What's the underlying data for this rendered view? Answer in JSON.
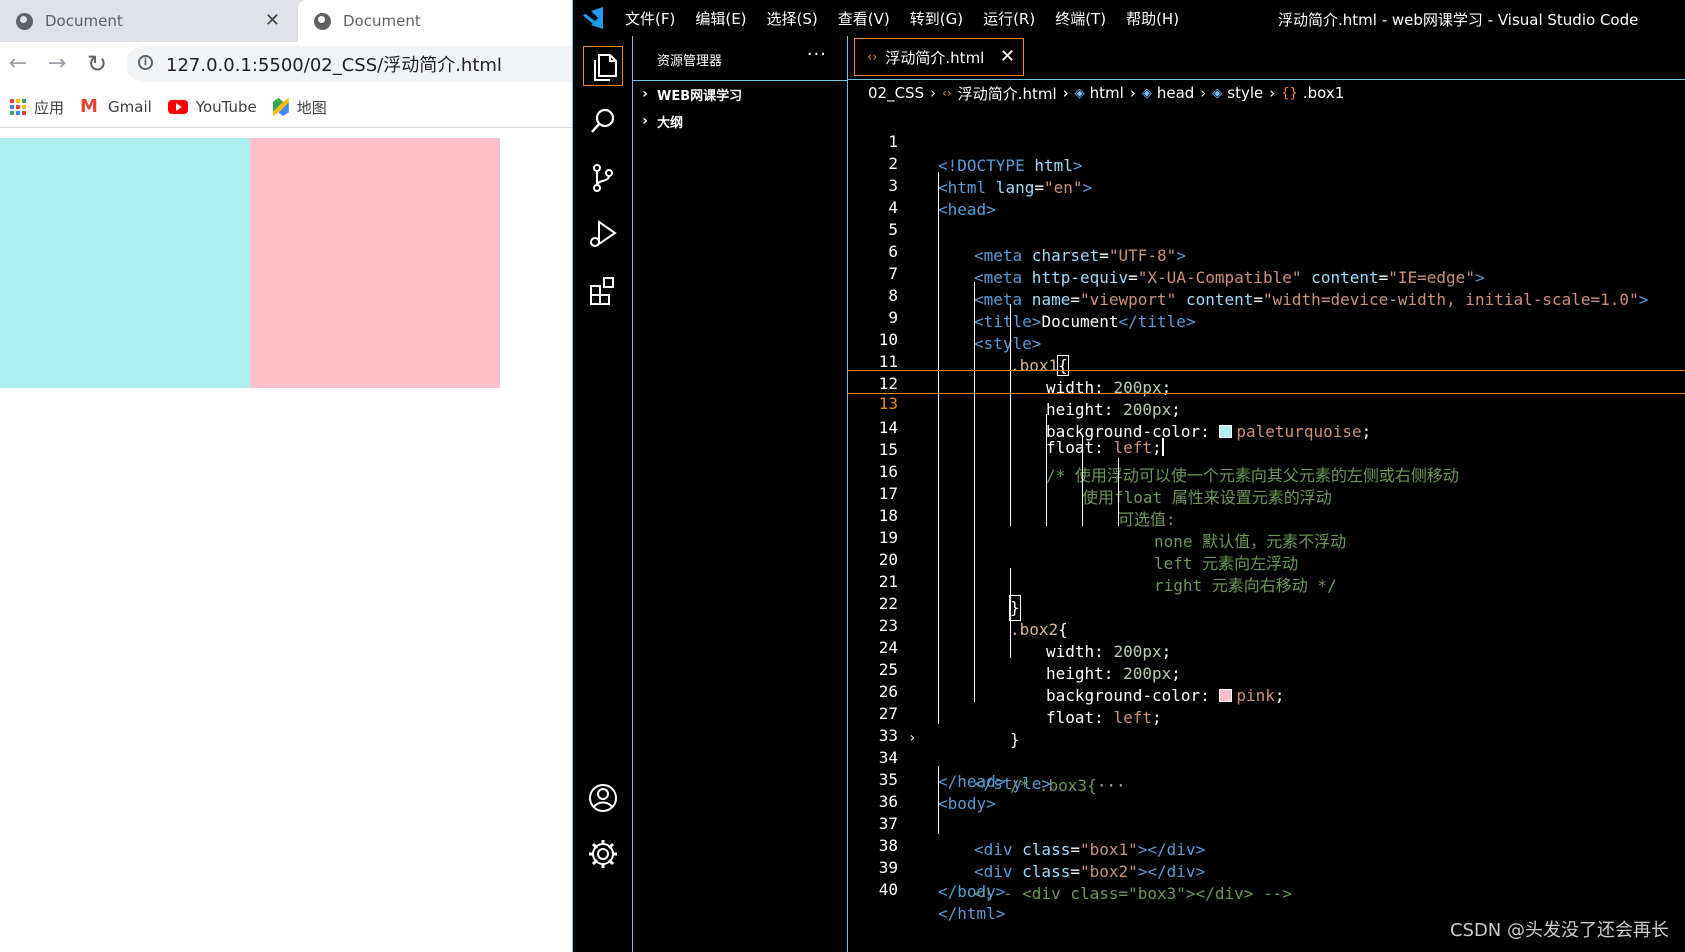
{
  "browser": {
    "tabs": [
      {
        "title": "Document"
      },
      {
        "title": "Document"
      }
    ],
    "url": "127.0.0.1:5500/02_CSS/浮动简介.html",
    "bookmarks": [
      {
        "label": "应用",
        "icon": "apps-icon"
      },
      {
        "label": "Gmail",
        "icon": "gmail-icon"
      },
      {
        "label": "YouTube",
        "icon": "youtube-icon"
      },
      {
        "label": "地图",
        "icon": "maps-icon"
      }
    ],
    "viewport": {
      "box1_color": "#afeeee",
      "box2_color": "#ffc0cb"
    }
  },
  "vscode": {
    "menu": [
      "文件(F)",
      "编辑(E)",
      "选择(S)",
      "查看(V)",
      "转到(G)",
      "运行(R)",
      "终端(T)",
      "帮助(H)"
    ],
    "window_title": "浮动简介.html - web网课学习 - Visual Studio Code",
    "explorer": {
      "title": "资源管理器",
      "more": "···",
      "sections": [
        "WEB网课学习",
        "大纲"
      ]
    },
    "editor_tab": "浮动简介.html",
    "breadcrumb": [
      "02_CSS",
      "浮动简介.html",
      "html",
      "head",
      "style",
      ".box1"
    ],
    "code_lines": [
      {
        "n": "1"
      },
      {
        "n": "2"
      },
      {
        "n": "3"
      },
      {
        "n": "4"
      },
      {
        "n": "5"
      },
      {
        "n": "6"
      },
      {
        "n": "7"
      },
      {
        "n": "8"
      },
      {
        "n": "9"
      },
      {
        "n": "10"
      },
      {
        "n": "11"
      },
      {
        "n": "12"
      },
      {
        "n": "13"
      },
      {
        "n": "14"
      },
      {
        "n": "15"
      },
      {
        "n": "16"
      },
      {
        "n": "17"
      },
      {
        "n": "18"
      },
      {
        "n": "19"
      },
      {
        "n": "20"
      },
      {
        "n": "21"
      },
      {
        "n": "22"
      },
      {
        "n": "23"
      },
      {
        "n": "24"
      },
      {
        "n": "25"
      },
      {
        "n": "26"
      },
      {
        "n": "27"
      },
      {
        "n": "33"
      },
      {
        "n": "34"
      },
      {
        "n": "35"
      },
      {
        "n": "36"
      },
      {
        "n": "37"
      },
      {
        "n": "38"
      },
      {
        "n": "39"
      },
      {
        "n": "40"
      }
    ],
    "code": {
      "l1": [
        "<!DOCTYPE",
        " html",
        ">"
      ],
      "l2": [
        "<html",
        " lang",
        "=",
        "\"en\"",
        ">"
      ],
      "l3": [
        "<head>"
      ],
      "l4": [
        "<meta",
        " charset",
        "=",
        "\"UTF-8\"",
        ">"
      ],
      "l5": [
        "<meta",
        " http-equiv",
        "=",
        "\"X-UA-Compatible\"",
        " content",
        "=",
        "\"IE=edge\"",
        ">"
      ],
      "l6": [
        "<meta",
        " name",
        "=",
        "\"viewport\"",
        " content",
        "=",
        "\"width=device-width, initial-scale=1.0\"",
        ">"
      ],
      "l7": [
        "<title>",
        "Document",
        "</title>"
      ],
      "l8": [
        "<style>"
      ],
      "l9": [
        ".box1",
        "{"
      ],
      "l10": [
        "width",
        ": ",
        "200px",
        ";"
      ],
      "l11": [
        "height",
        ": ",
        "200px",
        ";"
      ],
      "l12": [
        "background-color",
        ": ",
        "paleturquoise",
        ";"
      ],
      "l13": [
        "float",
        ": ",
        "left",
        ";"
      ],
      "l14": "/* 使用浮动可以使一个元素向其父元素的左侧或右侧移动",
      "l15": "使用float 属性来设置元素的浮动",
      "l16": "可选值:",
      "l17": "none 默认值，元素不浮动",
      "l18": "left 元素向左浮动",
      "l19": "right 元素向右移动 */",
      "l20": "}",
      "l21": [
        ".box2",
        "{"
      ],
      "l22": [
        "width",
        ": ",
        "200px",
        ";"
      ],
      "l23": [
        "height",
        ": ",
        "200px",
        ";"
      ],
      "l24": [
        "background-color",
        ": ",
        "pink",
        ";"
      ],
      "l25": [
        "float",
        ": ",
        "left",
        ";"
      ],
      "l26": "}",
      "l27": "/* .box3{",
      "l27_more": "···",
      "l33": "</style>",
      "l34": "</head>",
      "l35": "<body>",
      "l36": [
        "<div",
        " class",
        "=",
        "\"box1\"",
        "></div>"
      ],
      "l37": [
        "<div",
        " class",
        "=",
        "\"box2\"",
        "></div>"
      ],
      "l38": "<!-- <div class=\"box3\"></div> -->",
      "l39": "</body>",
      "l40": "</html>",
      "swatch1": "#afeeee",
      "swatch2": "#ffc0cb"
    },
    "watermark": "CSDN @头发没了还会再长"
  }
}
